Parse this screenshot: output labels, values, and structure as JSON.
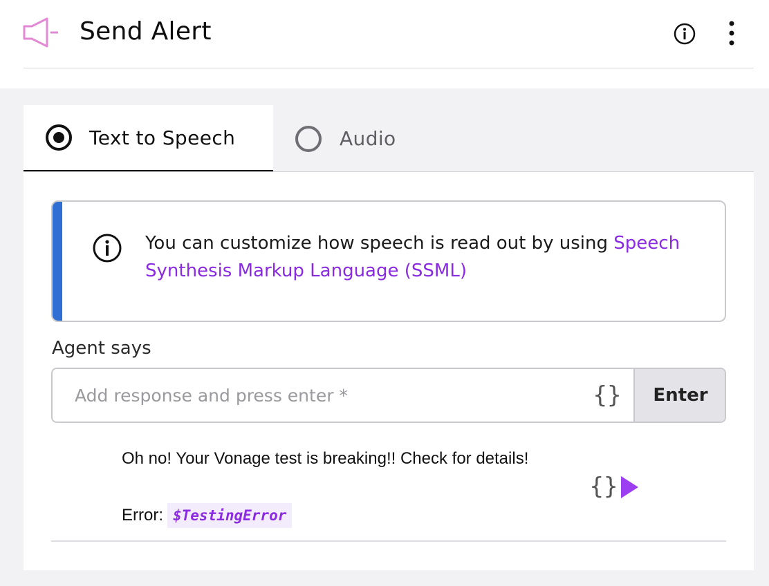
{
  "header": {
    "title": "Send Alert",
    "icon": "megaphone-icon",
    "icon_color": "#e28ad4"
  },
  "tabs": [
    {
      "label": "Text to Speech",
      "selected": true
    },
    {
      "label": "Audio",
      "selected": false
    }
  ],
  "notice": {
    "text": "You can customize how speech is read out by using ",
    "link_text": "Speech Synthesis Markup Language (SSML)",
    "accent_color": "#2f6fd4",
    "link_color": "#8a2be2"
  },
  "agent": {
    "label": "Agent says",
    "input_value": "",
    "input_placeholder": "Add response and press enter *",
    "enter_label": "Enter",
    "braces": "{}"
  },
  "responses": [
    {
      "line1": "Oh no! Your Vonage test is breaking!! Check for details!",
      "line2_prefix": "Error:",
      "variable": "$TestingError",
      "braces": "{}"
    }
  ]
}
